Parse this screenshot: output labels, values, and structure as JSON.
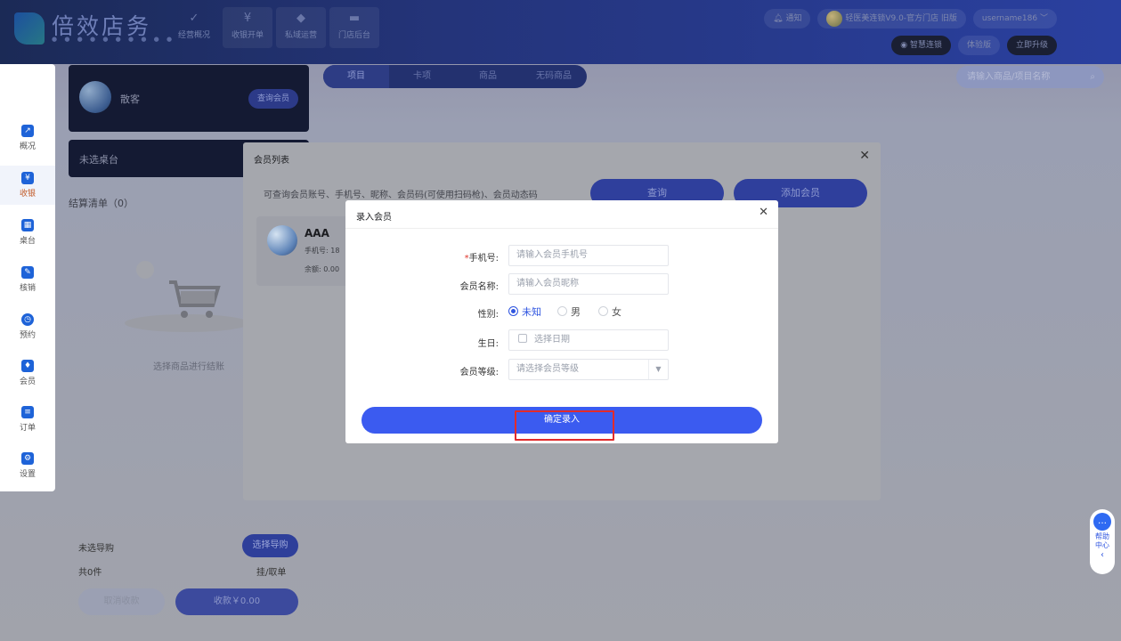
{
  "header": {
    "logo_text": "倍效店务",
    "nav": [
      {
        "icon": "✓",
        "label": "经营概况"
      },
      {
        "icon": "¥",
        "label": "收银开单"
      },
      {
        "icon": "◆",
        "label": "私域运营"
      },
      {
        "icon": "▬",
        "label": "门店后台"
      }
    ],
    "notice_label": "通知",
    "store_label": "轻医美连锁V9.0-官方门店 旧版",
    "user_label": "username186",
    "marketing_label": "智慧连锁",
    "trial_label": "体验版",
    "upgrade_label": "立即升级"
  },
  "sidebar": {
    "items": [
      {
        "icon": "↗",
        "label": "概况"
      },
      {
        "icon": "¥",
        "label": "收银"
      },
      {
        "icon": "▦",
        "label": "桌台"
      },
      {
        "icon": "✎",
        "label": "核销"
      },
      {
        "icon": "◷",
        "label": "预约"
      },
      {
        "icon": "♦",
        "label": "会员"
      },
      {
        "icon": "≡",
        "label": "订单"
      },
      {
        "icon": "⚙",
        "label": "设置"
      }
    ]
  },
  "left_panel": {
    "member_name": "散客",
    "query_member_label": "查询会员",
    "table_label": "未选桌台",
    "settle_title": "结算清单（0）",
    "empty_hint": "选择商品进行结账",
    "guide_label": "未选导购",
    "guide_button": "选择导购",
    "count_label": "共0件",
    "hang_label": "挂/取单",
    "cancel_button": "取消收款",
    "pay_button": "收款￥0.00"
  },
  "product_tabs": [
    "项目",
    "卡项",
    "商品",
    "无码商品"
  ],
  "search": {
    "placeholder": "请输入商品/项目名称"
  },
  "member_list_dialog": {
    "title": "会员列表",
    "hint": "可查询会员账号、手机号、昵称、会员码(可使用扫码枪)、会员动态码",
    "query_button": "查询",
    "add_button": "添加会员",
    "card": {
      "name": "AAA",
      "phone": "手机号: 18",
      "balance": "余额: 0.00"
    }
  },
  "enter_member_dialog": {
    "title": "录入会员",
    "phone_label": "手机号:",
    "phone_placeholder": "请输入会员手机号",
    "name_label": "会员名称:",
    "name_placeholder": "请输入会员昵称",
    "gender_label": "性别:",
    "gender_options": [
      "未知",
      "男",
      "女"
    ],
    "gender_selected": "未知",
    "birthday_label": "生日:",
    "birthday_placeholder": "选择日期",
    "level_label": "会员等级:",
    "level_placeholder": "请选择会员等级",
    "confirm_button": "确定录入"
  },
  "help": {
    "icon": "…",
    "label": "帮助中心",
    "chevron": "‹"
  }
}
